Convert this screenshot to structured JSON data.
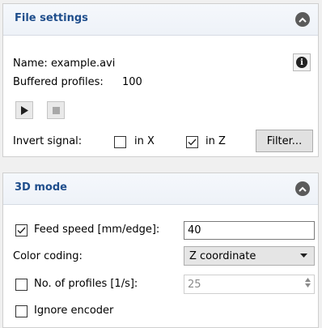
{
  "file_settings": {
    "title": "File settings",
    "name_label": "Name:",
    "name_value": "example.avi",
    "buffered_label": "Buffered profiles:",
    "buffered_value": "100",
    "invert_label": "Invert signal:",
    "in_x_label": "in X",
    "in_x_checked": false,
    "in_z_label": "in Z",
    "in_z_checked": true,
    "filter_button": "Filter..."
  },
  "mode_3d": {
    "title": "3D mode",
    "feed_speed_label": "Feed speed [mm/edge]:",
    "feed_speed_checked": true,
    "feed_speed_value": "40",
    "color_coding_label": "Color coding:",
    "color_coding_value": "Z coordinate",
    "profiles_label": "No. of profiles [1/s]:",
    "profiles_checked": false,
    "profiles_value": "25",
    "ignore_encoder_label": "Ignore encoder",
    "ignore_encoder_checked": false
  },
  "colors": {
    "header_title": "#1f4e8c",
    "collapse_button": "#5b5b5b"
  },
  "icons": [
    "chevron-up-icon",
    "info-icon",
    "play-icon",
    "stop-icon",
    "checkmark-icon",
    "dropdown-arrow-icon",
    "spin-arrows-icon"
  ]
}
